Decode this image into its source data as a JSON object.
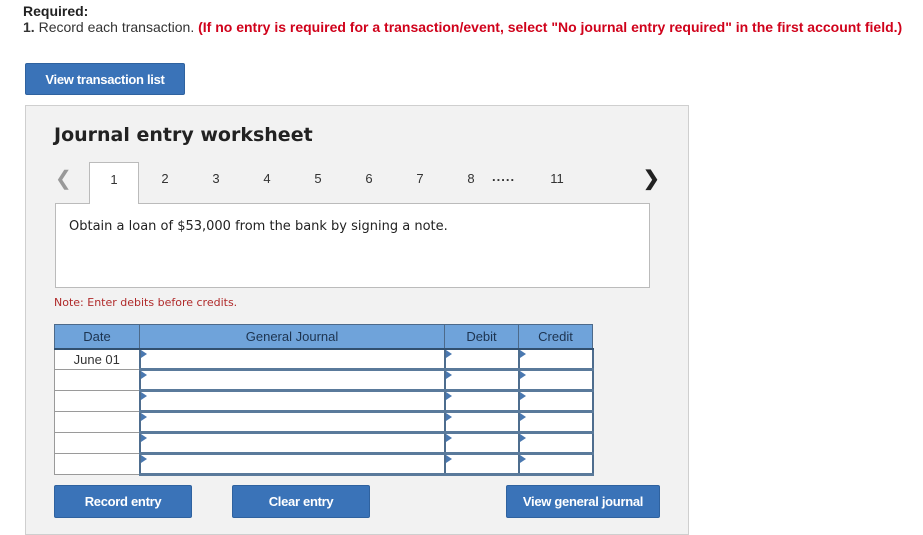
{
  "header": {
    "required_label": "Required:",
    "instruction_number": "1.",
    "instruction_text": " Record each transaction. ",
    "instruction_note": "(If no entry is required for a transaction/event, select \"No journal entry required\" in the first account field.)"
  },
  "buttons": {
    "view_transaction_list": "View transaction list",
    "record_entry": "Record entry",
    "clear_entry": "Clear entry",
    "view_general_journal": "View general journal"
  },
  "worksheet": {
    "title": "Journal entry worksheet",
    "nav_prev_icon": "chevron-left-icon",
    "nav_next_icon": "chevron-right-icon",
    "tabs": [
      "1",
      "2",
      "3",
      "4",
      "5",
      "6",
      "7",
      "8",
      "11"
    ],
    "active_tab": "1",
    "ellipsis": ".....",
    "transaction_description": "Obtain a loan of $53,000 from the bank by signing a note.",
    "note": "Note: Enter debits before credits."
  },
  "journal": {
    "columns": [
      "Date",
      "General Journal",
      "Debit",
      "Credit"
    ],
    "rows": [
      {
        "date": "June 01",
        "account": "",
        "debit": "",
        "credit": ""
      },
      {
        "date": "",
        "account": "",
        "debit": "",
        "credit": ""
      },
      {
        "date": "",
        "account": "",
        "debit": "",
        "credit": ""
      },
      {
        "date": "",
        "account": "",
        "debit": "",
        "credit": ""
      },
      {
        "date": "",
        "account": "",
        "debit": "",
        "credit": ""
      },
      {
        "date": "",
        "account": "",
        "debit": "",
        "credit": ""
      }
    ]
  },
  "colors": {
    "button_blue": "#3a73b8",
    "header_blue": "#6fa3da",
    "instruction_red": "#d0021b",
    "note_red": "#b02a2a",
    "panel_bg": "#f2f2f2"
  }
}
